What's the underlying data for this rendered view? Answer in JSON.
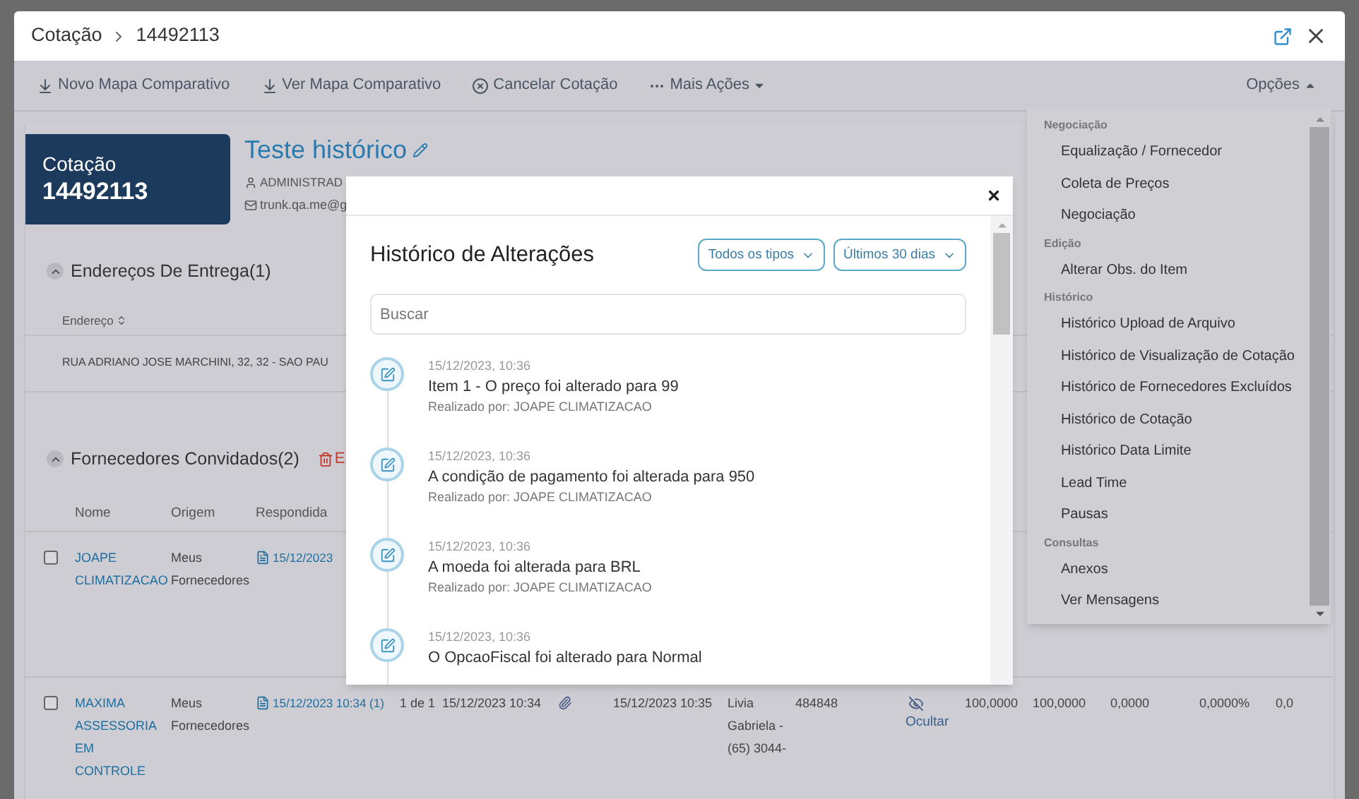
{
  "window": {
    "breadcrumb": [
      "Cotação",
      "14492113"
    ]
  },
  "toolbar": {
    "actions": [
      {
        "kind": "map",
        "label": "Novo Mapa Comparativo"
      },
      {
        "kind": "map",
        "label": "Ver Mapa Comparativo"
      },
      {
        "kind": "cancel",
        "label": "Cancelar Cotação"
      },
      {
        "kind": "more",
        "label": "Mais Ações"
      }
    ],
    "options": "Opções",
    "options_expanded": true
  },
  "quote": {
    "card_label": "Cotação",
    "card_number": "14492113",
    "title": "Teste histórico",
    "user": "ADMINISTRAD",
    "email": "trunk.qa.me@g"
  },
  "delivery": {
    "title": "Endereços De Entrega(1)",
    "expanded": true,
    "column": "Endereço",
    "rows": [
      "RUA ADRIANO JOSE MARCHINI, 32, 32 - SAO PAU"
    ]
  },
  "suppliers": {
    "title": "Fornecedores Convidados(2)",
    "expanded": true,
    "delete_label": "E",
    "columns": [
      "Nome",
      "Origem",
      "Respondida"
    ],
    "rows": [
      {
        "checked": false,
        "cells": [
          {
            "kind": "link",
            "text": "JOAPE CLIMATIZACAO"
          },
          {
            "kind": "text",
            "text": "Meus Fornecedores"
          },
          {
            "kind": "doc",
            "text": "15/12/2023"
          }
        ]
      },
      {
        "checked": false,
        "cells": [
          {
            "kind": "link",
            "text": "MAXIMA ASSESSORIA EM CONTROLE"
          },
          {
            "kind": "text",
            "text": "Meus Fornecedores"
          },
          {
            "kind": "doc",
            "text": "15/12/2023 10:34 (1)"
          },
          {
            "kind": "text",
            "text": "1 de 1"
          },
          {
            "kind": "text",
            "text": "15/12/2023 10:34"
          },
          {
            "kind": "clip"
          },
          {
            "kind": "text",
            "text": "15/12/2023 10:35"
          },
          {
            "kind": "text",
            "text": "Livia Gabriela - (65) 3044-"
          },
          {
            "kind": "text",
            "text": "484848"
          },
          {
            "kind": "eye",
            "text": "Ocultar"
          },
          {
            "kind": "text",
            "text": "100,0000"
          },
          {
            "kind": "text",
            "text": "100,0000"
          },
          {
            "kind": "text",
            "text": "0,0000"
          },
          {
            "kind": "text",
            "text": "0,0000%"
          },
          {
            "kind": "text",
            "text": "0,0"
          }
        ]
      }
    ]
  },
  "history_modal": {
    "title": "Histórico de Alterações",
    "filters": [
      "Todos os tipos",
      "Últimos 30 dias"
    ],
    "search_placeholder": "Buscar",
    "entries": [
      {
        "date": "15/12/2023, 10:36",
        "text": "Item 1 - O preço foi alterado para 99",
        "by": "Realizado por: JOAPE CLIMATIZACAO"
      },
      {
        "date": "15/12/2023, 10:36",
        "text": "A condição de pagamento foi alterada para 950",
        "by": "Realizado por: JOAPE CLIMATIZACAO"
      },
      {
        "date": "15/12/2023, 10:36",
        "text": "A moeda foi alterada para BRL",
        "by": "Realizado por: JOAPE CLIMATIZACAO"
      },
      {
        "date": "15/12/2023, 10:36",
        "text": "O OpcaoFiscal foi alterado para Normal"
      }
    ]
  },
  "options_menu": {
    "groups": [
      {
        "heading": "Negociação",
        "items": [
          "Equalização / Fornecedor",
          "Coleta de Preços",
          "Negociação"
        ]
      },
      {
        "heading": "Edição",
        "items": [
          "Alterar Obs. do Item"
        ]
      },
      {
        "heading": "Histórico",
        "items": [
          "Histórico Upload de Arquivo",
          "Histórico de Visualização de Cotação",
          "Histórico de Fornecedores Excluídos",
          "Histórico de Cotação",
          "Histórico Data Limite",
          "Lead Time",
          "Pausas"
        ]
      },
      {
        "heading": "Consultas",
        "items": [
          "Anexos",
          "Ver Mensagens"
        ]
      }
    ]
  }
}
